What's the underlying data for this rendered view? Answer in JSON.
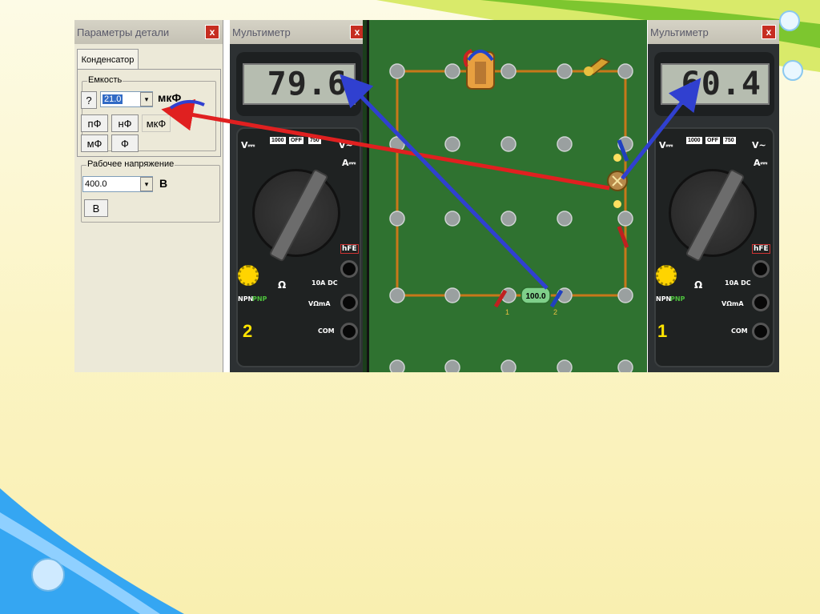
{
  "dialog": {
    "title": "Параметры детали",
    "close": "x",
    "tab": "Конденсатор",
    "capacitance": {
      "group": "Емкость",
      "help_button": "?",
      "value": "21.0",
      "dropdown": "▾",
      "unit": "мкФ",
      "unit_buttons": [
        "пФ",
        "нФ",
        "мкФ",
        "мФ",
        "Ф"
      ]
    },
    "voltage": {
      "group": "Рабочее напряжение",
      "value": "400.0",
      "dropdown": "▾",
      "unit": "В",
      "button": "В"
    }
  },
  "meter_left": {
    "title": "Мультиметр",
    "close": "x",
    "display": "79.6",
    "number": "2",
    "labels": {
      "v_dc": "V⎓",
      "v_ac": "V~",
      "a_dc": "A⎓",
      "hfe": "hFE",
      "npn": "NPN",
      "pnp": "PNP",
      "off": "OFF",
      "r1000": "1000",
      "r750": "750",
      "dc10": "10A DC",
      "vohm": "VΩmA",
      "com": "COM",
      "ohm": "Ω"
    }
  },
  "meter_right": {
    "title": "Мультиметр",
    "close": "x",
    "display": "60.4",
    "number": "1",
    "labels": {
      "v_dc": "V⎓",
      "v_ac": "V~",
      "a_dc": "A⎓",
      "hfe": "hFE",
      "npn": "NPN",
      "pnp": "PNP",
      "off": "OFF",
      "r1000": "1000",
      "r750": "750",
      "dc10": "10A DC",
      "vohm": "VΩmA",
      "com": "COM",
      "ohm": "Ω"
    }
  },
  "board": {
    "resistor_value": "100.0",
    "probe_labels": [
      "1",
      "2"
    ]
  },
  "colors": {
    "board": "#2f7230",
    "arrow_red": "#e02020",
    "arrow_blue": "#3040d0",
    "meter_number": "#ffe400",
    "wire": "#c8781a"
  },
  "icons": [
    "close-icon",
    "capacitor-icon",
    "switch-icon",
    "resistor-icon",
    "lamp-icon",
    "probe-icon",
    "dial-icon"
  ]
}
